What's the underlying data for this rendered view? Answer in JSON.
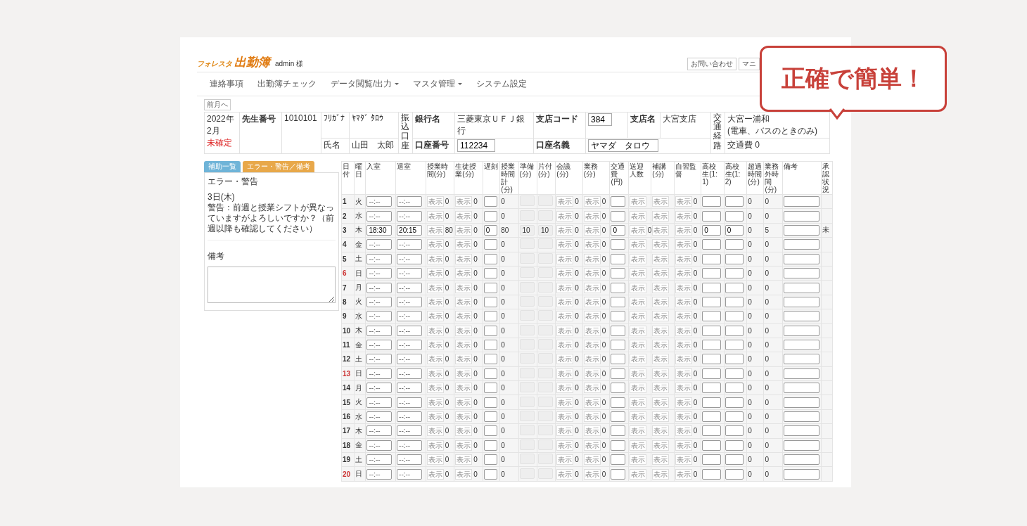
{
  "header": {
    "logo_small": "フォレスタ",
    "logo": "出勤簿",
    "user": "admin 様",
    "top_buttons": [
      "お問い合わせ",
      "マニ"
    ]
  },
  "nav": [
    {
      "label": "連絡事項",
      "dropdown": false
    },
    {
      "label": "出勤簿チェック",
      "dropdown": false
    },
    {
      "label": "データ閲覧/出力",
      "dropdown": true
    },
    {
      "label": "マスタ管理",
      "dropdown": true
    },
    {
      "label": "システム設定",
      "dropdown": false
    }
  ],
  "prev_month": "前月へ",
  "info": {
    "year": "2022年",
    "month": "2月",
    "status": "未確定",
    "teacher_no_label": "先生番号",
    "teacher_no": "1010101",
    "kana_label": "ﾌﾘｶﾞﾅ",
    "kana": "ﾔﾏﾀﾞ ﾀﾛｳ",
    "name_label": "氏名",
    "name": "山田　太郎",
    "account_label": "振込口座",
    "bank_label": "銀行名",
    "bank": "三菱東京ＵＦＪ銀行",
    "account_no_label": "口座番号",
    "account_no": "112234",
    "branch_code_label": "支店コード",
    "branch_code": "384",
    "holder_label": "口座名義",
    "holder": "ヤマダ　タロウ",
    "branch_label": "支店名",
    "branch": "大宮支店",
    "route_label": "交通経路",
    "route": "大宮ー浦和",
    "route_note": "(電車、バスのときのみ)",
    "fare": "交通費 0"
  },
  "side": {
    "tabs": [
      {
        "label": "補助一覧",
        "selected": false
      },
      {
        "label": "エラー・警告／備考",
        "selected": true
      }
    ],
    "error_title": "エラー・警告",
    "error_date": "3日(木)",
    "error_message": "警告：前週と授業シフトが異なっていますがよろしいですか？（前週以降も確認してください）",
    "note_title": "備考"
  },
  "callout": "正確で簡単！",
  "table": {
    "columns": [
      "日付",
      "曜日",
      "入室",
      "退室",
      "授業時間(分)",
      "生徒授業(分)",
      "遅刻",
      "授業時間計(分)",
      "準備(分)",
      "片付(分)",
      "会議(分)",
      "業務(分)",
      "交通費(円)",
      "送迎人数",
      "補講(分)",
      "自習監督",
      "高校生(1:1)",
      "高校生(1:2)",
      "超過時間(分)",
      "業務外時間(分)",
      "備考",
      "承認状況"
    ],
    "rows": [
      {
        "cells": [
          {
            "kind": "day",
            "value": "1",
            "holiday": false
          },
          {
            "kind": "text",
            "value": "火"
          },
          {
            "kind": "time",
            "placeholder": "--:--"
          },
          {
            "kind": "time",
            "placeholder": "--:--"
          },
          {
            "kind": "button",
            "button": "表示",
            "value": "0"
          },
          {
            "kind": "button",
            "button": "表示",
            "value": "0"
          },
          {
            "kind": "input"
          },
          {
            "kind": "text",
            "value": "0"
          },
          {
            "kind": "locked"
          },
          {
            "kind": "locked"
          },
          {
            "kind": "button",
            "button": "表示",
            "value": "0"
          },
          {
            "kind": "button",
            "button": "表示",
            "value": "0"
          },
          {
            "kind": "input"
          },
          {
            "kind": "button",
            "button": "表示"
          },
          {
            "kind": "button",
            "button": "表示"
          },
          {
            "kind": "button",
            "button": "表示",
            "value": "0"
          },
          {
            "kind": "input"
          },
          {
            "kind": "input"
          },
          {
            "kind": "text",
            "value": "0"
          },
          {
            "kind": "text",
            "value": "0"
          },
          {
            "kind": "input"
          },
          {
            "kind": "text"
          }
        ]
      },
      {
        "cells": [
          {
            "kind": "day",
            "value": "2",
            "holiday": false
          },
          {
            "kind": "text",
            "value": "水"
          },
          {
            "kind": "time",
            "placeholder": "--:--"
          },
          {
            "kind": "time",
            "placeholder": "--:--"
          },
          {
            "kind": "button",
            "button": "表示",
            "value": "0"
          },
          {
            "kind": "button",
            "button": "表示",
            "value": "0"
          },
          {
            "kind": "input"
          },
          {
            "kind": "text",
            "value": "0"
          },
          {
            "kind": "locked"
          },
          {
            "kind": "locked"
          },
          {
            "kind": "button",
            "button": "表示",
            "value": "0"
          },
          {
            "kind": "button",
            "button": "表示",
            "value": "0"
          },
          {
            "kind": "input"
          },
          {
            "kind": "button",
            "button": "表示"
          },
          {
            "kind": "button",
            "button": "表示"
          },
          {
            "kind": "button",
            "button": "表示",
            "value": "0"
          },
          {
            "kind": "input"
          },
          {
            "kind": "input"
          },
          {
            "kind": "text",
            "value": "0"
          },
          {
            "kind": "text",
            "value": "0"
          },
          {
            "kind": "input"
          },
          {
            "kind": "text"
          }
        ]
      },
      {
        "cells": [
          {
            "kind": "day",
            "value": "3",
            "holiday": false
          },
          {
            "kind": "text",
            "value": "木"
          },
          {
            "kind": "time",
            "value": "18:30"
          },
          {
            "kind": "time",
            "value": "20:15"
          },
          {
            "kind": "button",
            "button": "表示",
            "value": "80"
          },
          {
            "kind": "button",
            "button": "表示",
            "value": "0"
          },
          {
            "kind": "input",
            "value": "0"
          },
          {
            "kind": "text",
            "value": "80"
          },
          {
            "kind": "locked",
            "value": "10"
          },
          {
            "kind": "locked",
            "value": "10"
          },
          {
            "kind": "button",
            "button": "表示",
            "value": "0"
          },
          {
            "kind": "button",
            "button": "表示",
            "value": "0"
          },
          {
            "kind": "input",
            "value": "0"
          },
          {
            "kind": "button",
            "button": "表示",
            "value": "0"
          },
          {
            "kind": "button",
            "button": "表示"
          },
          {
            "kind": "button",
            "button": "表示",
            "value": "0"
          },
          {
            "kind": "input",
            "value": "0"
          },
          {
            "kind": "input",
            "value": "0"
          },
          {
            "kind": "text",
            "value": "0"
          },
          {
            "kind": "text",
            "value": "5"
          },
          {
            "kind": "input"
          },
          {
            "kind": "text",
            "value": "未"
          }
        ]
      },
      {
        "cells": [
          {
            "kind": "day",
            "value": "4",
            "holiday": false
          },
          {
            "kind": "text",
            "value": "金"
          },
          {
            "kind": "time",
            "placeholder": "--:--"
          },
          {
            "kind": "time",
            "placeholder": "--:--"
          },
          {
            "kind": "button",
            "button": "表示",
            "value": "0"
          },
          {
            "kind": "button",
            "button": "表示",
            "value": "0"
          },
          {
            "kind": "input"
          },
          {
            "kind": "text",
            "value": "0"
          },
          {
            "kind": "locked"
          },
          {
            "kind": "locked"
          },
          {
            "kind": "button",
            "button": "表示",
            "value": "0"
          },
          {
            "kind": "button",
            "button": "表示",
            "value": "0"
          },
          {
            "kind": "input"
          },
          {
            "kind": "button",
            "button": "表示"
          },
          {
            "kind": "button",
            "button": "表示"
          },
          {
            "kind": "button",
            "button": "表示",
            "value": "0"
          },
          {
            "kind": "input"
          },
          {
            "kind": "input"
          },
          {
            "kind": "text",
            "value": "0"
          },
          {
            "kind": "text",
            "value": "0"
          },
          {
            "kind": "input"
          },
          {
            "kind": "text"
          }
        ]
      },
      {
        "cells": [
          {
            "kind": "day",
            "value": "5",
            "holiday": false
          },
          {
            "kind": "text",
            "value": "土"
          },
          {
            "kind": "time",
            "placeholder": "--:--"
          },
          {
            "kind": "time",
            "placeholder": "--:--"
          },
          {
            "kind": "button",
            "button": "表示",
            "value": "0"
          },
          {
            "kind": "button",
            "button": "表示",
            "value": "0"
          },
          {
            "kind": "input"
          },
          {
            "kind": "text",
            "value": "0"
          },
          {
            "kind": "locked"
          },
          {
            "kind": "locked"
          },
          {
            "kind": "button",
            "button": "表示",
            "value": "0"
          },
          {
            "kind": "button",
            "button": "表示",
            "value": "0"
          },
          {
            "kind": "input"
          },
          {
            "kind": "button",
            "button": "表示"
          },
          {
            "kind": "button",
            "button": "表示"
          },
          {
            "kind": "button",
            "button": "表示",
            "value": "0"
          },
          {
            "kind": "input"
          },
          {
            "kind": "input"
          },
          {
            "kind": "text",
            "value": "0"
          },
          {
            "kind": "text",
            "value": "0"
          },
          {
            "kind": "input"
          },
          {
            "kind": "text"
          }
        ]
      },
      {
        "cells": [
          {
            "kind": "day",
            "value": "6",
            "holiday": true
          },
          {
            "kind": "text",
            "value": "日"
          },
          {
            "kind": "time",
            "placeholder": "--:--"
          },
          {
            "kind": "time",
            "placeholder": "--:--"
          },
          {
            "kind": "button",
            "button": "表示",
            "value": "0"
          },
          {
            "kind": "button",
            "button": "表示",
            "value": "0"
          },
          {
            "kind": "input"
          },
          {
            "kind": "text",
            "value": "0"
          },
          {
            "kind": "locked"
          },
          {
            "kind": "locked"
          },
          {
            "kind": "button",
            "button": "表示",
            "value": "0"
          },
          {
            "kind": "button",
            "button": "表示",
            "value": "0"
          },
          {
            "kind": "input"
          },
          {
            "kind": "button",
            "button": "表示"
          },
          {
            "kind": "button",
            "button": "表示"
          },
          {
            "kind": "button",
            "button": "表示",
            "value": "0"
          },
          {
            "kind": "input"
          },
          {
            "kind": "input"
          },
          {
            "kind": "text",
            "value": "0"
          },
          {
            "kind": "text",
            "value": "0"
          },
          {
            "kind": "input"
          },
          {
            "kind": "text"
          }
        ]
      },
      {
        "cells": [
          {
            "kind": "day",
            "value": "7",
            "holiday": false
          },
          {
            "kind": "text",
            "value": "月"
          },
          {
            "kind": "time",
            "placeholder": "--:--"
          },
          {
            "kind": "time",
            "placeholder": "--:--"
          },
          {
            "kind": "button",
            "button": "表示",
            "value": "0"
          },
          {
            "kind": "button",
            "button": "表示",
            "value": "0"
          },
          {
            "kind": "input"
          },
          {
            "kind": "text",
            "value": "0"
          },
          {
            "kind": "locked"
          },
          {
            "kind": "locked"
          },
          {
            "kind": "button",
            "button": "表示",
            "value": "0"
          },
          {
            "kind": "button",
            "button": "表示",
            "value": "0"
          },
          {
            "kind": "input"
          },
          {
            "kind": "button",
            "button": "表示"
          },
          {
            "kind": "button",
            "button": "表示"
          },
          {
            "kind": "button",
            "button": "表示",
            "value": "0"
          },
          {
            "kind": "input"
          },
          {
            "kind": "input"
          },
          {
            "kind": "text",
            "value": "0"
          },
          {
            "kind": "text",
            "value": "0"
          },
          {
            "kind": "input"
          },
          {
            "kind": "text"
          }
        ]
      },
      {
        "cells": [
          {
            "kind": "day",
            "value": "8",
            "holiday": false
          },
          {
            "kind": "text",
            "value": "火"
          },
          {
            "kind": "time",
            "placeholder": "--:--"
          },
          {
            "kind": "time",
            "placeholder": "--:--"
          },
          {
            "kind": "button",
            "button": "表示",
            "value": "0"
          },
          {
            "kind": "button",
            "button": "表示",
            "value": "0"
          },
          {
            "kind": "input"
          },
          {
            "kind": "text",
            "value": "0"
          },
          {
            "kind": "locked"
          },
          {
            "kind": "locked"
          },
          {
            "kind": "button",
            "button": "表示",
            "value": "0"
          },
          {
            "kind": "button",
            "button": "表示",
            "value": "0"
          },
          {
            "kind": "input"
          },
          {
            "kind": "button",
            "button": "表示"
          },
          {
            "kind": "button",
            "button": "表示"
          },
          {
            "kind": "button",
            "button": "表示",
            "value": "0"
          },
          {
            "kind": "input"
          },
          {
            "kind": "input"
          },
          {
            "kind": "text",
            "value": "0"
          },
          {
            "kind": "text",
            "value": "0"
          },
          {
            "kind": "input"
          },
          {
            "kind": "text"
          }
        ]
      },
      {
        "cells": [
          {
            "kind": "day",
            "value": "9",
            "holiday": false
          },
          {
            "kind": "text",
            "value": "水"
          },
          {
            "kind": "time",
            "placeholder": "--:--"
          },
          {
            "kind": "time",
            "placeholder": "--:--"
          },
          {
            "kind": "button",
            "button": "表示",
            "value": "0"
          },
          {
            "kind": "button",
            "button": "表示",
            "value": "0"
          },
          {
            "kind": "input"
          },
          {
            "kind": "text",
            "value": "0"
          },
          {
            "kind": "locked"
          },
          {
            "kind": "locked"
          },
          {
            "kind": "button",
            "button": "表示",
            "value": "0"
          },
          {
            "kind": "button",
            "button": "表示",
            "value": "0"
          },
          {
            "kind": "input"
          },
          {
            "kind": "button",
            "button": "表示"
          },
          {
            "kind": "button",
            "button": "表示"
          },
          {
            "kind": "button",
            "button": "表示",
            "value": "0"
          },
          {
            "kind": "input"
          },
          {
            "kind": "input"
          },
          {
            "kind": "text",
            "value": "0"
          },
          {
            "kind": "text",
            "value": "0"
          },
          {
            "kind": "input"
          },
          {
            "kind": "text"
          }
        ]
      },
      {
        "cells": [
          {
            "kind": "day",
            "value": "10",
            "holiday": false
          },
          {
            "kind": "text",
            "value": "木"
          },
          {
            "kind": "time",
            "placeholder": "--:--"
          },
          {
            "kind": "time",
            "placeholder": "--:--"
          },
          {
            "kind": "button",
            "button": "表示",
            "value": "0"
          },
          {
            "kind": "button",
            "button": "表示",
            "value": "0"
          },
          {
            "kind": "input"
          },
          {
            "kind": "text",
            "value": "0"
          },
          {
            "kind": "locked"
          },
          {
            "kind": "locked"
          },
          {
            "kind": "button",
            "button": "表示",
            "value": "0"
          },
          {
            "kind": "button",
            "button": "表示",
            "value": "0"
          },
          {
            "kind": "input"
          },
          {
            "kind": "button",
            "button": "表示"
          },
          {
            "kind": "button",
            "button": "表示"
          },
          {
            "kind": "button",
            "button": "表示",
            "value": "0"
          },
          {
            "kind": "input"
          },
          {
            "kind": "input"
          },
          {
            "kind": "text",
            "value": "0"
          },
          {
            "kind": "text",
            "value": "0"
          },
          {
            "kind": "input"
          },
          {
            "kind": "text"
          }
        ]
      },
      {
        "cells": [
          {
            "kind": "day",
            "value": "11",
            "holiday": false
          },
          {
            "kind": "text",
            "value": "金"
          },
          {
            "kind": "time",
            "placeholder": "--:--"
          },
          {
            "kind": "time",
            "placeholder": "--:--"
          },
          {
            "kind": "button",
            "button": "表示",
            "value": "0"
          },
          {
            "kind": "button",
            "button": "表示",
            "value": "0"
          },
          {
            "kind": "input"
          },
          {
            "kind": "text",
            "value": "0"
          },
          {
            "kind": "locked"
          },
          {
            "kind": "locked"
          },
          {
            "kind": "button",
            "button": "表示",
            "value": "0"
          },
          {
            "kind": "button",
            "button": "表示",
            "value": "0"
          },
          {
            "kind": "input"
          },
          {
            "kind": "button",
            "button": "表示"
          },
          {
            "kind": "button",
            "button": "表示"
          },
          {
            "kind": "button",
            "button": "表示",
            "value": "0"
          },
          {
            "kind": "input"
          },
          {
            "kind": "input"
          },
          {
            "kind": "text",
            "value": "0"
          },
          {
            "kind": "text",
            "value": "0"
          },
          {
            "kind": "input"
          },
          {
            "kind": "text"
          }
        ]
      },
      {
        "cells": [
          {
            "kind": "day",
            "value": "12",
            "holiday": false
          },
          {
            "kind": "text",
            "value": "土"
          },
          {
            "kind": "time",
            "placeholder": "--:--"
          },
          {
            "kind": "time",
            "placeholder": "--:--"
          },
          {
            "kind": "button",
            "button": "表示",
            "value": "0"
          },
          {
            "kind": "button",
            "button": "表示",
            "value": "0"
          },
          {
            "kind": "input"
          },
          {
            "kind": "text",
            "value": "0"
          },
          {
            "kind": "locked"
          },
          {
            "kind": "locked"
          },
          {
            "kind": "button",
            "button": "表示",
            "value": "0"
          },
          {
            "kind": "button",
            "button": "表示",
            "value": "0"
          },
          {
            "kind": "input"
          },
          {
            "kind": "button",
            "button": "表示"
          },
          {
            "kind": "button",
            "button": "表示"
          },
          {
            "kind": "button",
            "button": "表示",
            "value": "0"
          },
          {
            "kind": "input"
          },
          {
            "kind": "input"
          },
          {
            "kind": "text",
            "value": "0"
          },
          {
            "kind": "text",
            "value": "0"
          },
          {
            "kind": "input"
          },
          {
            "kind": "text"
          }
        ]
      },
      {
        "cells": [
          {
            "kind": "day",
            "value": "13",
            "holiday": true
          },
          {
            "kind": "text",
            "value": "日"
          },
          {
            "kind": "time",
            "placeholder": "--:--"
          },
          {
            "kind": "time",
            "placeholder": "--:--"
          },
          {
            "kind": "button",
            "button": "表示",
            "value": "0"
          },
          {
            "kind": "button",
            "button": "表示",
            "value": "0"
          },
          {
            "kind": "input"
          },
          {
            "kind": "text",
            "value": "0"
          },
          {
            "kind": "locked"
          },
          {
            "kind": "locked"
          },
          {
            "kind": "button",
            "button": "表示",
            "value": "0"
          },
          {
            "kind": "button",
            "button": "表示",
            "value": "0"
          },
          {
            "kind": "input"
          },
          {
            "kind": "button",
            "button": "表示"
          },
          {
            "kind": "button",
            "button": "表示"
          },
          {
            "kind": "button",
            "button": "表示",
            "value": "0"
          },
          {
            "kind": "input"
          },
          {
            "kind": "input"
          },
          {
            "kind": "text",
            "value": "0"
          },
          {
            "kind": "text",
            "value": "0"
          },
          {
            "kind": "input"
          },
          {
            "kind": "text"
          }
        ]
      },
      {
        "cells": [
          {
            "kind": "day",
            "value": "14",
            "holiday": false
          },
          {
            "kind": "text",
            "value": "月"
          },
          {
            "kind": "time",
            "placeholder": "--:--"
          },
          {
            "kind": "time",
            "placeholder": "--:--"
          },
          {
            "kind": "button",
            "button": "表示",
            "value": "0"
          },
          {
            "kind": "button",
            "button": "表示",
            "value": "0"
          },
          {
            "kind": "input"
          },
          {
            "kind": "text",
            "value": "0"
          },
          {
            "kind": "locked"
          },
          {
            "kind": "locked"
          },
          {
            "kind": "button",
            "button": "表示",
            "value": "0"
          },
          {
            "kind": "button",
            "button": "表示",
            "value": "0"
          },
          {
            "kind": "input"
          },
          {
            "kind": "button",
            "button": "表示"
          },
          {
            "kind": "button",
            "button": "表示"
          },
          {
            "kind": "button",
            "button": "表示",
            "value": "0"
          },
          {
            "kind": "input"
          },
          {
            "kind": "input"
          },
          {
            "kind": "text",
            "value": "0"
          },
          {
            "kind": "text",
            "value": "0"
          },
          {
            "kind": "input"
          },
          {
            "kind": "text"
          }
        ]
      },
      {
        "cells": [
          {
            "kind": "day",
            "value": "15",
            "holiday": false
          },
          {
            "kind": "text",
            "value": "火"
          },
          {
            "kind": "time",
            "placeholder": "--:--"
          },
          {
            "kind": "time",
            "placeholder": "--:--"
          },
          {
            "kind": "button",
            "button": "表示",
            "value": "0"
          },
          {
            "kind": "button",
            "button": "表示",
            "value": "0"
          },
          {
            "kind": "input"
          },
          {
            "kind": "text",
            "value": "0"
          },
          {
            "kind": "locked"
          },
          {
            "kind": "locked"
          },
          {
            "kind": "button",
            "button": "表示",
            "value": "0"
          },
          {
            "kind": "button",
            "button": "表示",
            "value": "0"
          },
          {
            "kind": "input"
          },
          {
            "kind": "button",
            "button": "表示"
          },
          {
            "kind": "button",
            "button": "表示"
          },
          {
            "kind": "button",
            "button": "表示",
            "value": "0"
          },
          {
            "kind": "input"
          },
          {
            "kind": "input"
          },
          {
            "kind": "text",
            "value": "0"
          },
          {
            "kind": "text",
            "value": "0"
          },
          {
            "kind": "input"
          },
          {
            "kind": "text"
          }
        ]
      },
      {
        "cells": [
          {
            "kind": "day",
            "value": "16",
            "holiday": false
          },
          {
            "kind": "text",
            "value": "水"
          },
          {
            "kind": "time",
            "placeholder": "--:--"
          },
          {
            "kind": "time",
            "placeholder": "--:--"
          },
          {
            "kind": "button",
            "button": "表示",
            "value": "0"
          },
          {
            "kind": "button",
            "button": "表示",
            "value": "0"
          },
          {
            "kind": "input"
          },
          {
            "kind": "text",
            "value": "0"
          },
          {
            "kind": "locked"
          },
          {
            "kind": "locked"
          },
          {
            "kind": "button",
            "button": "表示",
            "value": "0"
          },
          {
            "kind": "button",
            "button": "表示",
            "value": "0"
          },
          {
            "kind": "input"
          },
          {
            "kind": "button",
            "button": "表示"
          },
          {
            "kind": "button",
            "button": "表示"
          },
          {
            "kind": "button",
            "button": "表示",
            "value": "0"
          },
          {
            "kind": "input"
          },
          {
            "kind": "input"
          },
          {
            "kind": "text",
            "value": "0"
          },
          {
            "kind": "text",
            "value": "0"
          },
          {
            "kind": "input"
          },
          {
            "kind": "text"
          }
        ]
      },
      {
        "cells": [
          {
            "kind": "day",
            "value": "17",
            "holiday": false
          },
          {
            "kind": "text",
            "value": "木"
          },
          {
            "kind": "time",
            "placeholder": "--:--"
          },
          {
            "kind": "time",
            "placeholder": "--:--"
          },
          {
            "kind": "button",
            "button": "表示",
            "value": "0"
          },
          {
            "kind": "button",
            "button": "表示",
            "value": "0"
          },
          {
            "kind": "input"
          },
          {
            "kind": "text",
            "value": "0"
          },
          {
            "kind": "locked"
          },
          {
            "kind": "locked"
          },
          {
            "kind": "button",
            "button": "表示",
            "value": "0"
          },
          {
            "kind": "button",
            "button": "表示",
            "value": "0"
          },
          {
            "kind": "input"
          },
          {
            "kind": "button",
            "button": "表示"
          },
          {
            "kind": "button",
            "button": "表示"
          },
          {
            "kind": "button",
            "button": "表示",
            "value": "0"
          },
          {
            "kind": "input"
          },
          {
            "kind": "input"
          },
          {
            "kind": "text",
            "value": "0"
          },
          {
            "kind": "text",
            "value": "0"
          },
          {
            "kind": "input"
          },
          {
            "kind": "text"
          }
        ]
      },
      {
        "cells": [
          {
            "kind": "day",
            "value": "18",
            "holiday": false
          },
          {
            "kind": "text",
            "value": "金"
          },
          {
            "kind": "time",
            "placeholder": "--:--"
          },
          {
            "kind": "time",
            "placeholder": "--:--"
          },
          {
            "kind": "button",
            "button": "表示",
            "value": "0"
          },
          {
            "kind": "button",
            "button": "表示",
            "value": "0"
          },
          {
            "kind": "input"
          },
          {
            "kind": "text",
            "value": "0"
          },
          {
            "kind": "locked"
          },
          {
            "kind": "locked"
          },
          {
            "kind": "button",
            "button": "表示",
            "value": "0"
          },
          {
            "kind": "button",
            "button": "表示",
            "value": "0"
          },
          {
            "kind": "input"
          },
          {
            "kind": "button",
            "button": "表示"
          },
          {
            "kind": "button",
            "button": "表示"
          },
          {
            "kind": "button",
            "button": "表示",
            "value": "0"
          },
          {
            "kind": "input"
          },
          {
            "kind": "input"
          },
          {
            "kind": "text",
            "value": "0"
          },
          {
            "kind": "text",
            "value": "0"
          },
          {
            "kind": "input"
          },
          {
            "kind": "text"
          }
        ]
      },
      {
        "cells": [
          {
            "kind": "day",
            "value": "19",
            "holiday": false
          },
          {
            "kind": "text",
            "value": "土"
          },
          {
            "kind": "time",
            "placeholder": "--:--"
          },
          {
            "kind": "time",
            "placeholder": "--:--"
          },
          {
            "kind": "button",
            "button": "表示",
            "value": "0"
          },
          {
            "kind": "button",
            "button": "表示",
            "value": "0"
          },
          {
            "kind": "input"
          },
          {
            "kind": "text",
            "value": "0"
          },
          {
            "kind": "locked"
          },
          {
            "kind": "locked"
          },
          {
            "kind": "button",
            "button": "表示",
            "value": "0"
          },
          {
            "kind": "button",
            "button": "表示",
            "value": "0"
          },
          {
            "kind": "input"
          },
          {
            "kind": "button",
            "button": "表示"
          },
          {
            "kind": "button",
            "button": "表示"
          },
          {
            "kind": "button",
            "button": "表示",
            "value": "0"
          },
          {
            "kind": "input"
          },
          {
            "kind": "input"
          },
          {
            "kind": "text",
            "value": "0"
          },
          {
            "kind": "text",
            "value": "0"
          },
          {
            "kind": "input"
          },
          {
            "kind": "text"
          }
        ]
      },
      {
        "cells": [
          {
            "kind": "day",
            "value": "20",
            "holiday": true
          },
          {
            "kind": "text",
            "value": "日"
          },
          {
            "kind": "time",
            "placeholder": "--:--"
          },
          {
            "kind": "time",
            "placeholder": "--:--"
          },
          {
            "kind": "button",
            "button": "表示",
            "value": "0"
          },
          {
            "kind": "button",
            "button": "表示",
            "value": "0"
          },
          {
            "kind": "input"
          },
          {
            "kind": "text",
            "value": "0"
          },
          {
            "kind": "locked"
          },
          {
            "kind": "locked"
          },
          {
            "kind": "button",
            "button": "表示",
            "value": "0"
          },
          {
            "kind": "button",
            "button": "表示",
            "value": "0"
          },
          {
            "kind": "input"
          },
          {
            "kind": "button",
            "button": "表示"
          },
          {
            "kind": "button",
            "button": "表示"
          },
          {
            "kind": "button",
            "button": "表示",
            "value": "0"
          },
          {
            "kind": "input"
          },
          {
            "kind": "input"
          },
          {
            "kind": "text",
            "value": "0"
          },
          {
            "kind": "text",
            "value": "0"
          },
          {
            "kind": "input"
          },
          {
            "kind": "text"
          }
        ]
      }
    ]
  }
}
